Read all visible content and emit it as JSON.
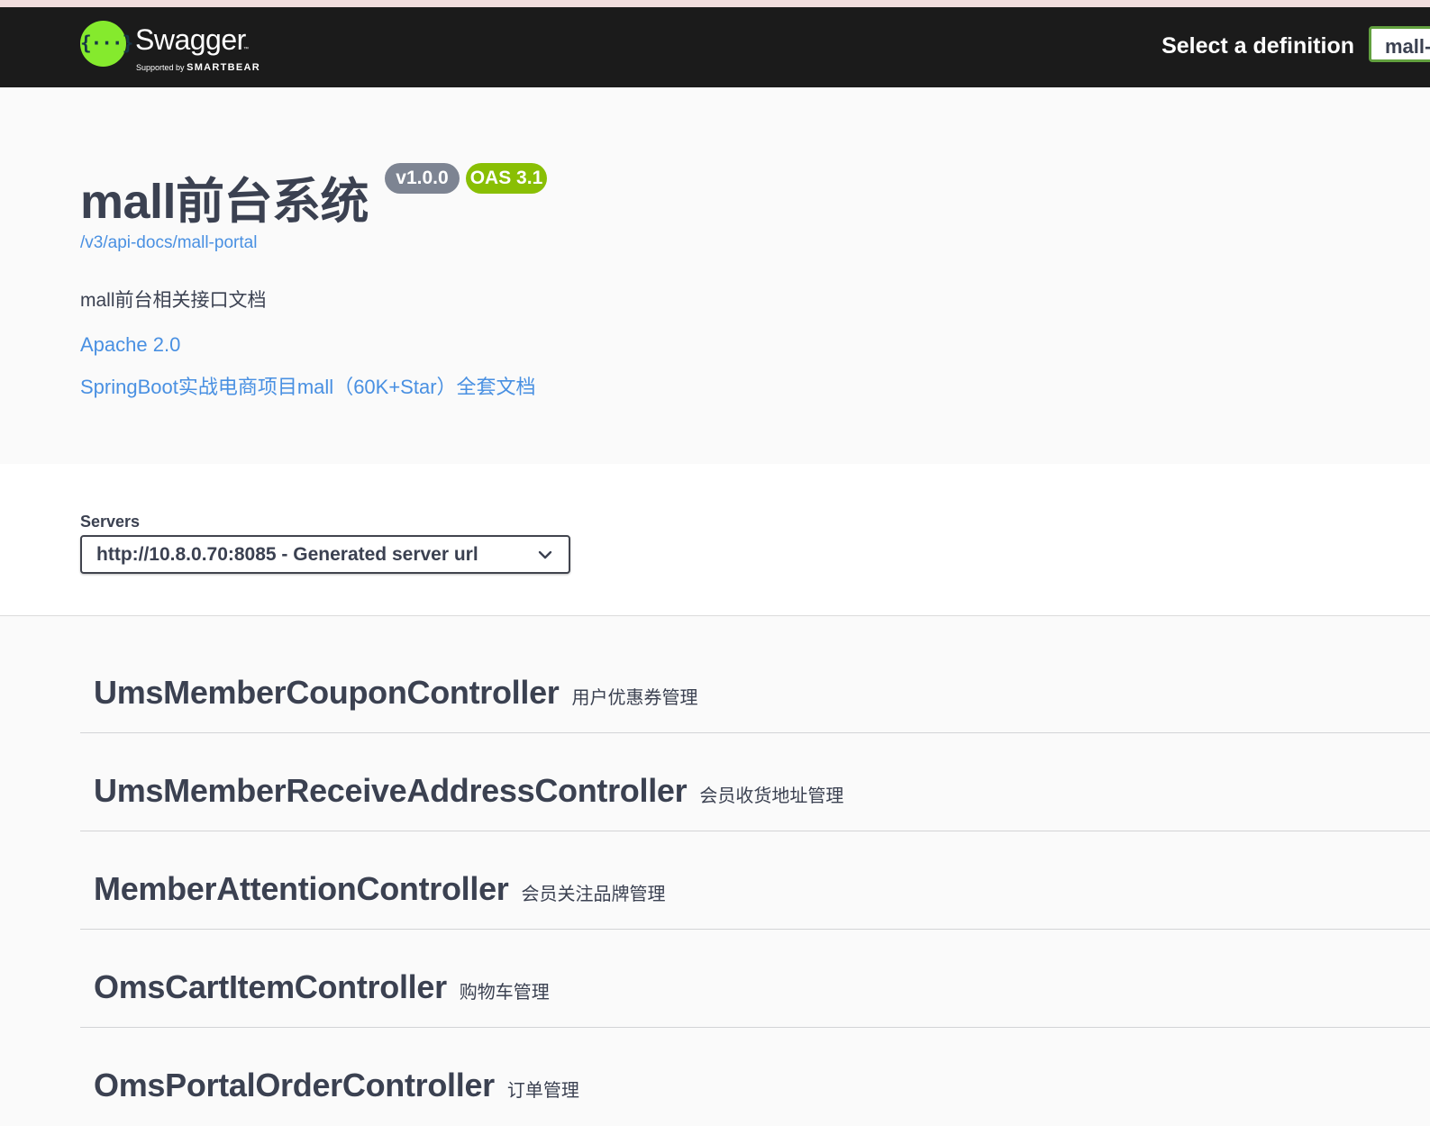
{
  "header": {
    "logo": {
      "icon_text": "{···}",
      "brand": "Swagger",
      "trademark": "™",
      "supported_by": "Supported by",
      "vendor": "SMARTBEAR"
    },
    "select_definition_label": "Select a definition",
    "definition_value": "mall-portal",
    "colors": {
      "bar": "#1b1b1b",
      "logo": "#85ea2d",
      "select_border": "#62a03f"
    }
  },
  "info": {
    "title": "mall前台系统",
    "version_badge": "v1.0.0",
    "oas_badge": "OAS 3.1",
    "api_url": "/v3/api-docs/mall-portal",
    "description": "mall前台相关接口文档",
    "license_link": "Apache 2.0",
    "docs_link": "SpringBoot实战电商项目mall（60K+Star）全套文档",
    "colors": {
      "link": "#4990e2",
      "version_badge": "#7d8492",
      "oas_badge": "#89bf04"
    }
  },
  "servers": {
    "label": "Servers",
    "selected": "http://10.8.0.70:8085 - Generated server url",
    "icon": "chevron-down-icon"
  },
  "tags": [
    {
      "name": "UmsMemberCouponController",
      "description": "用户优惠券管理"
    },
    {
      "name": "UmsMemberReceiveAddressController",
      "description": "会员收货地址管理"
    },
    {
      "name": "MemberAttentionController",
      "description": "会员关注品牌管理"
    },
    {
      "name": "OmsCartItemController",
      "description": "购物车管理"
    },
    {
      "name": "OmsPortalOrderController",
      "description": "订单管理"
    }
  ]
}
